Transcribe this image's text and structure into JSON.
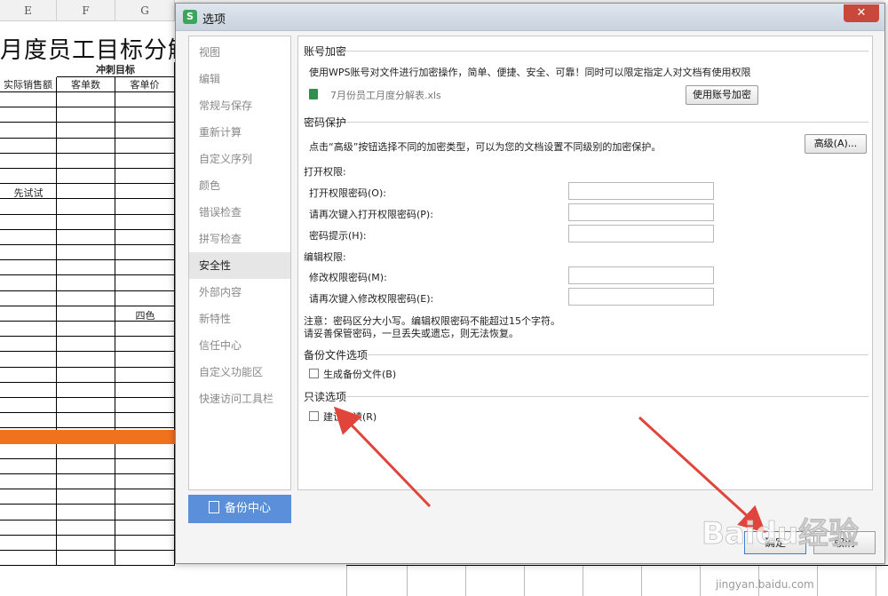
{
  "sheet": {
    "columns": [
      "E",
      "F",
      "G"
    ],
    "title": "月度员工目标分解表",
    "group_header": "冲刺目标",
    "headers": [
      "实际销售额",
      "客单数",
      "客单价"
    ],
    "cell_e": "先试试",
    "cell_g": "四色"
  },
  "dialog": {
    "title": "选项",
    "close": "✕",
    "nav": [
      "视图",
      "编辑",
      "常规与保存",
      "重新计算",
      "自定义序列",
      "颜色",
      "错误检查",
      "拼写检查",
      "安全性",
      "外部内容",
      "新特性",
      "信任中心",
      "自定义功能区",
      "快速访问工具栏"
    ],
    "backup_center": "备份中心",
    "account": {
      "heading": "账号加密",
      "desc": "使用WPS账号对文件进行加密操作，简单、便捷、安全、可靠！同时可以限定指定人对文档有使用权限",
      "file": "7月份员工月度分解表.xls",
      "button": "使用账号加密"
    },
    "password": {
      "heading": "密码保护",
      "desc": "点击“高级”按钮选择不同的加密类型，可以为您的文档设置不同级别的加密保护。",
      "advanced": "高级(A)...",
      "open_perm": "打开权限:",
      "open_pw": "打开权限密码(O):",
      "open_pw_again": "请再次键入打开权限密码(P):",
      "hint": "密码提示(H):",
      "edit_perm": "编辑权限:",
      "edit_pw": "修改权限密码(M):",
      "edit_pw_again": "请再次键入修改权限密码(E):",
      "note1": "注意：密码区分大小写。编辑权限密码不能超过15个字符。",
      "note2": "请妥善保管密码，一旦丢失或遗忘，则无法恢复。"
    },
    "backup": {
      "heading": "备份文件选项",
      "checkbox": "生成备份文件(B)"
    },
    "readonly": {
      "heading": "只读选项",
      "checkbox": "建议只读(R)"
    },
    "ok": "确定",
    "cancel": "取消"
  },
  "watermark": {
    "brand": "Baidu经验",
    "url": "jingyan.baidu.com"
  }
}
